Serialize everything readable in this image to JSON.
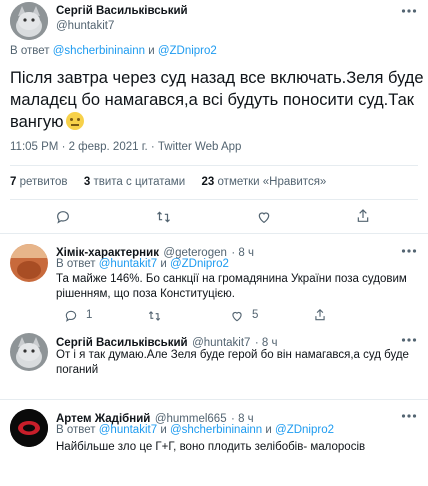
{
  "main_tweet": {
    "author_name": "Сергій Васильківський",
    "author_handle": "@huntakit7",
    "reply_prefix": "В ответ",
    "reply_to_1": "@shcherbininainn",
    "reply_and": "и",
    "reply_to_2": "@ZDnipro2",
    "text_line1": "Після завтра через суд назад все включать.Зеля буде",
    "text_line2": "маладєц бо намагався,а всі будуть поносити суд.Так",
    "text_line3": "вангую",
    "emoji": "🙄",
    "timestamp": "11:05 PM · 2 февр. 2021 г. · Twitter Web App"
  },
  "stats": {
    "retweets_count": "7",
    "retweets_label": "ретвитов",
    "quotes_count": "3",
    "quotes_label": "твита с цитатами",
    "likes_count": "23",
    "likes_label": "отметки «Нравится»"
  },
  "replies": [
    {
      "author_name": "Хімік-характерник",
      "author_handle": "@geterogen",
      "time": "· 8 ч",
      "reply_prefix": "В ответ",
      "reply_to_1": "@huntakit7",
      "reply_and": "и",
      "reply_to_2": "@ZDnipro2",
      "text_line1": "Та майже 146%. Бо санкції на громадянина України поза судовим",
      "text_line2": "рішенням, що поза Конституцією.",
      "reply_count": "1",
      "like_count": "5"
    },
    {
      "author_name": "Сергій Васильківський",
      "author_handle": "@huntakit7",
      "time": "· 8 ч",
      "text_line1": "От і я так думаю.Але Зеля буде герой бо він намагався,а суд буде",
      "text_line2": "поганий"
    },
    {
      "author_name": "Артем Жадібний",
      "author_handle": "@hummel665",
      "time": "· 8 ч",
      "reply_prefix": "В ответ",
      "reply_to_1": "@huntakit7",
      "reply_and": "и",
      "reply_to_2": "@shcherbininainn",
      "reply_and_2": "и",
      "reply_to_3": "@ZDnipro2",
      "text_line1": "Найбільше зло це Г+Г, воно плодить зелібобів- малоросів"
    }
  ],
  "colors": {
    "accent": "#1d9bf0",
    "muted": "#536471",
    "divider": "#e6ecf0"
  }
}
